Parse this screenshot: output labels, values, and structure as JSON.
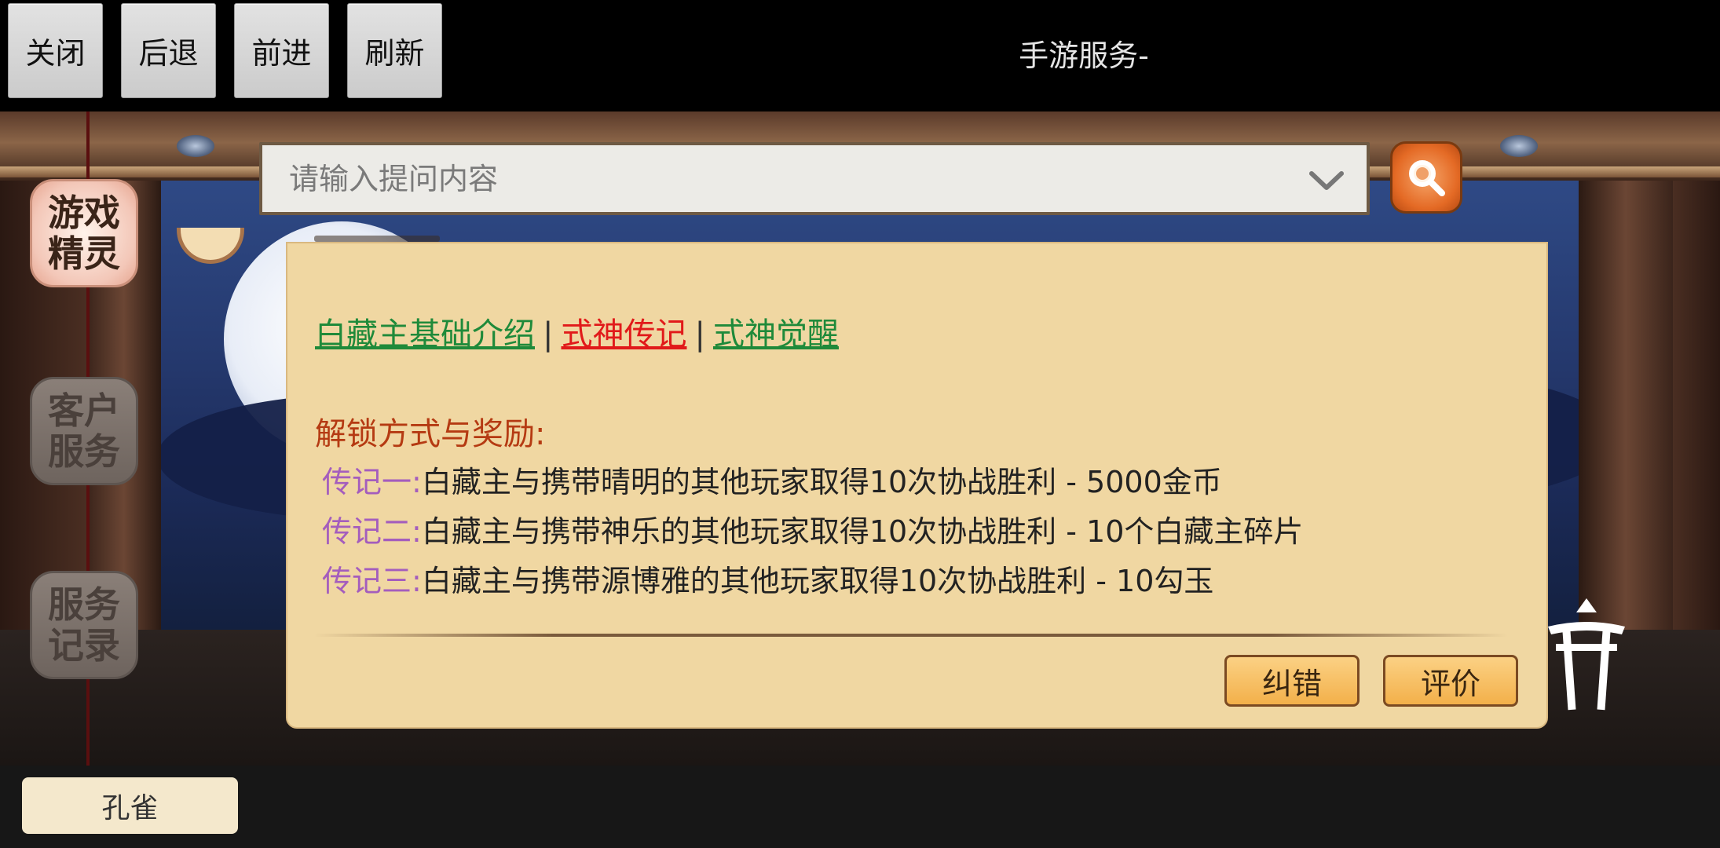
{
  "toolbar": {
    "close": "关闭",
    "back": "后退",
    "forward": "前进",
    "refresh": "刷新",
    "title": "手游服务-"
  },
  "side_tabs": {
    "game_spirit": "游戏精灵",
    "customer_service": "客户服务",
    "service_record": "服务记录"
  },
  "search": {
    "placeholder": "请输入提问内容",
    "dropdown_icon": "chevron-down-icon",
    "button_icon": "magnifier-icon"
  },
  "answer": {
    "links": {
      "basic_intro": "白藏主基础介绍",
      "separator": "|",
      "biography": "式神传记",
      "awakening": "式神觉醒"
    },
    "unlock_title": "解锁方式与奖励:",
    "biographies": [
      {
        "label": "传记一:",
        "text": "白藏主与携带晴明的其他玩家取得10次协战胜利 - 5000金币"
      },
      {
        "label": "传记二:",
        "text": "白藏主与携带神乐的其他玩家取得10次协战胜利 - 10个白藏主碎片"
      },
      {
        "label": "传记三:",
        "text": "白藏主与携带源博雅的其他玩家取得10次协战胜利 - 10勾玉"
      }
    ],
    "correct_button": "纠错",
    "rate_button": "评价"
  },
  "bottom": {
    "tag": "孔雀"
  },
  "colors": {
    "panel_bg": "#f0d7a2",
    "link_green": "#1f8a3a",
    "link_red": "#e11a1a",
    "section_title": "#b53a12",
    "bio_label": "#a45dbd",
    "button_orange": "#f3b04a",
    "search_button": "#e46a25"
  }
}
